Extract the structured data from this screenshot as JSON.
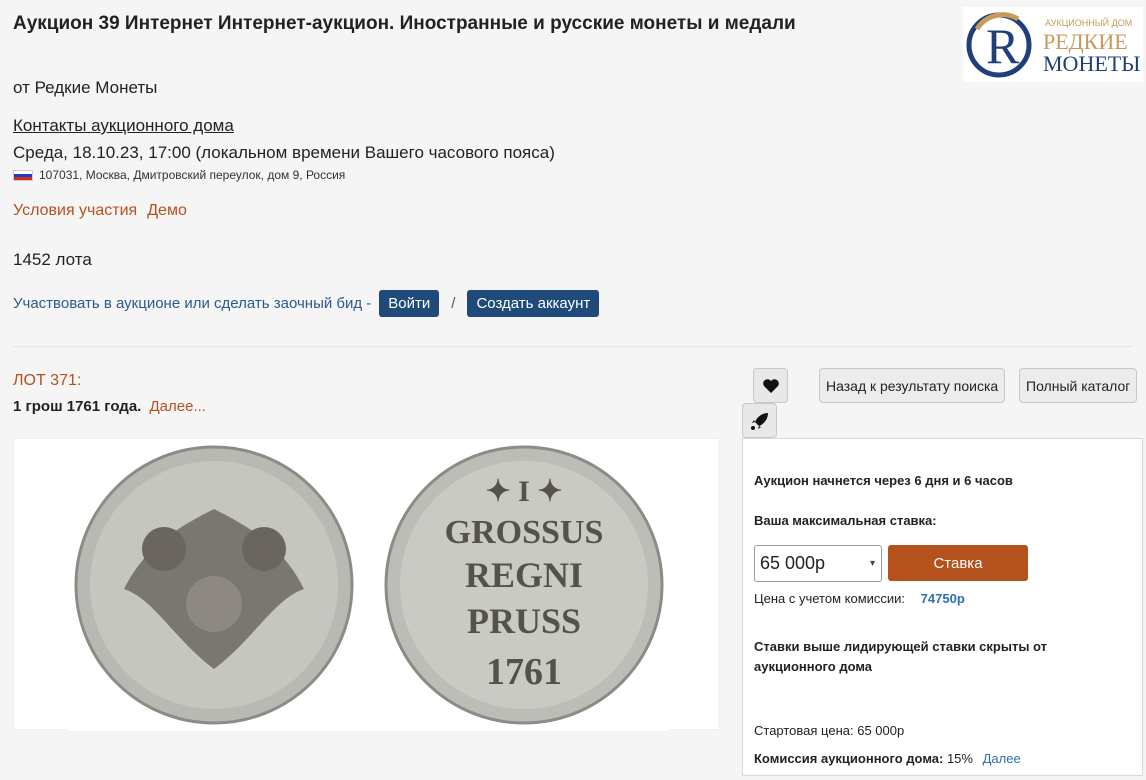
{
  "auction": {
    "title": "Аукцион 39 Интернет Интернет-аукцион. Иностранные и русские монеты и медали",
    "from": "от Редкие Монеты",
    "contacts_link": "Контакты аукционного дома",
    "date": "Среда, 18.10.23, 17:00 (локальном времени Вашего часового пояса)",
    "address": "107031, Москва, Дмитровский переулок, дом 9, Россия",
    "terms_link": "Условия участия",
    "demo_link": "Демо",
    "lots_count": "1452 лота",
    "participate_text": "Участвовать в аукционе или сделать заочный бид -",
    "login_button": "Войти",
    "separator": "/",
    "create_account_button": "Создать аккаунт"
  },
  "logo": {
    "small": "АУКЦИОННЫЙ ДОМ",
    "line1": "РЕДКИЕ",
    "line2": "МОНЕТЫ",
    "letter": "R"
  },
  "lot": {
    "number": "ЛОТ 371:",
    "title": "1 грош 1761 года.",
    "more_link": "Далее...",
    "reverse_legend": [
      "✦ I ✦",
      "GROSSUS",
      "REGNI",
      "PRUSS",
      "1761"
    ]
  },
  "actions": {
    "favorite_icon": "heart-icon",
    "notify_icon": "rocket-icon",
    "back_button": "Назад к результату поиска",
    "catalog_button": "Полный каталог"
  },
  "bid_panel": {
    "starts_in": "Аукцион начнется через 6 дня и 6 часов",
    "max_bid_label": "Ваша максимальная ставка:",
    "selected_bid": "65 000р",
    "bid_button": "Ставка",
    "commission_price_label": "Цена с учетом комиссии:",
    "commission_price_value": "74750р",
    "hidden_bids_note": "Ставки выше лидирующей ставки скрыты от аукционного дома",
    "start_price_label": "Стартовая цена:",
    "start_price_value": "65 000р",
    "house_commission_label": "Комиссия аукционного дома:",
    "house_commission_value": "15%",
    "house_commission_more": "Далее"
  },
  "colors": {
    "accent": "#b5511c",
    "primary_button": "#1f4a7a",
    "link_blue": "#2f6fb0"
  }
}
